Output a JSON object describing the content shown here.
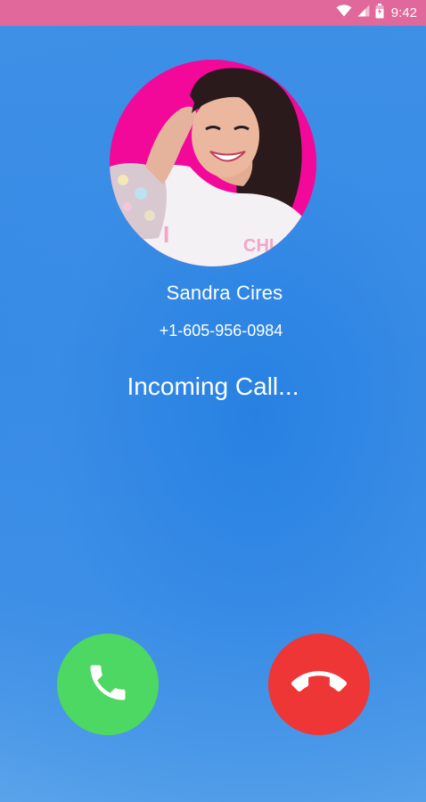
{
  "status_bar": {
    "time": "9:42",
    "background_color": "#e0689a",
    "icons": [
      "wifi-icon",
      "signal-icon",
      "battery-icon"
    ]
  },
  "caller": {
    "name": "Sandra Cires",
    "number": "+1-605-956-0984",
    "avatar_background_color": "#f2099a"
  },
  "call": {
    "status_text": "Incoming Call..."
  },
  "buttons": {
    "accept": {
      "icon": "phone-icon",
      "color": "#4cd862"
    },
    "decline": {
      "icon": "hang-up-icon",
      "color": "#ee3636"
    }
  },
  "colors": {
    "background": "#3a8ee6",
    "text": "#ffffff"
  }
}
